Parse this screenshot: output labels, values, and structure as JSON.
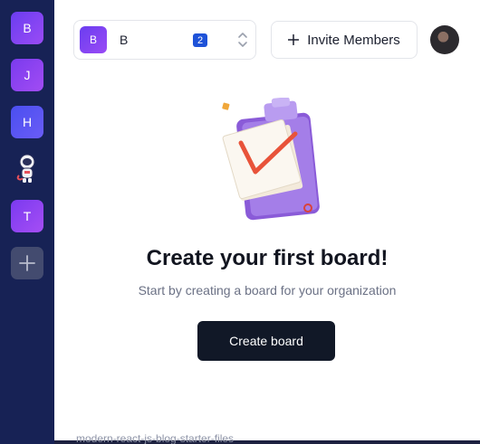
{
  "sidebar": {
    "orgs": [
      {
        "label": "B"
      },
      {
        "label": "J"
      },
      {
        "label": "H"
      },
      {
        "label": ""
      },
      {
        "label": "T"
      }
    ],
    "add_icon": "plus-icon"
  },
  "header": {
    "org_switcher": {
      "avatar_letter": "B",
      "name": "B",
      "badge": "2",
      "icon": "chevron-up-down-icon"
    },
    "invite_label": "Invite Members",
    "invite_icon": "plus-icon"
  },
  "empty_state": {
    "title": "Create your first board!",
    "subtitle": "Start by creating a board for your organization",
    "button_label": "Create board"
  },
  "footer": {
    "text": "modern-react-js-blog-starter-files"
  },
  "colors": {
    "sidebar_bg": "#172255",
    "primary_button": "#111827",
    "badge": "#1e52d8"
  }
}
